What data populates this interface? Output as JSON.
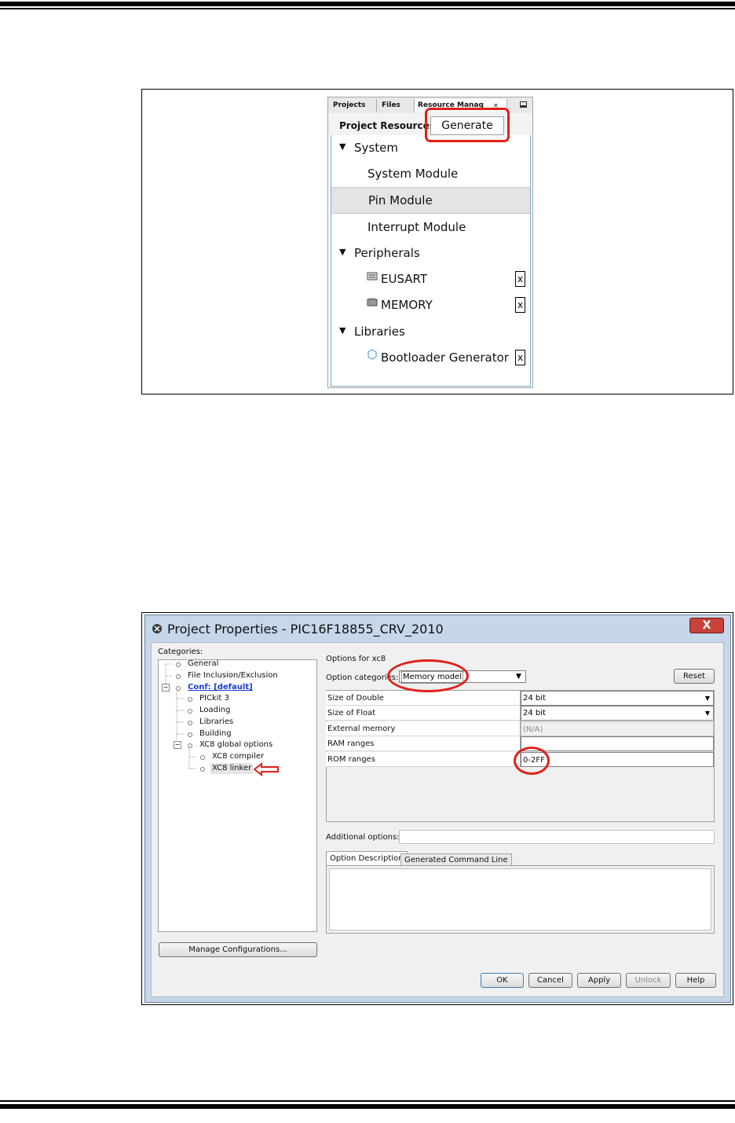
{
  "resource_manager": {
    "tabs": [
      "Projects",
      "Files",
      "Resource Manag"
    ],
    "tab_close": "✕",
    "header_label": "Project Resources",
    "generate_label": "Generate",
    "groups": [
      {
        "label": "System",
        "items": [
          "System Module",
          "Pin Module",
          "Interrupt Module"
        ]
      },
      {
        "label": "Peripherals",
        "items": [
          "EUSART",
          "MEMORY"
        ]
      },
      {
        "label": "Libraries",
        "items": [
          "Bootloader Generator"
        ]
      }
    ],
    "remove_label": "x",
    "selected_item": "Pin Module"
  },
  "project_properties": {
    "title": "Project Properties - PIC16F18855_CRV_2010",
    "close_label": "X",
    "categories_label": "Categories:",
    "categories": [
      "General",
      "File Inclusion/Exclusion",
      "Conf: [default]",
      "PICkit 3",
      "Loading",
      "Libraries",
      "Building",
      "XC8 global options",
      "XC8 compiler",
      "XC8 linker"
    ],
    "selected_category": "XC8 linker",
    "options_for_label": "Options for xc8",
    "option_categories_label": "Option categories:",
    "option_category_value": "Memory model",
    "reset_label": "Reset",
    "options": [
      {
        "name": "Size of Double",
        "value": "24 bit"
      },
      {
        "name": "Size of Float",
        "value": "24 bit"
      },
      {
        "name": "External memory",
        "value": "(N/A)"
      },
      {
        "name": "RAM ranges",
        "value": ""
      },
      {
        "name": "ROM ranges",
        "value": "0-2FF"
      }
    ],
    "additional_options_label": "Additional options:",
    "additional_options_value": "",
    "desc_tabs": [
      "Option Description",
      "Generated Command Line"
    ],
    "manage_label": "Manage Configurations...",
    "buttons": [
      "OK",
      "Cancel",
      "Apply",
      "Unlock",
      "Help"
    ]
  },
  "colors": {
    "highlight": "#e0201a",
    "window_frame": "#c7d7ea",
    "selection": "#e4e4e4"
  }
}
